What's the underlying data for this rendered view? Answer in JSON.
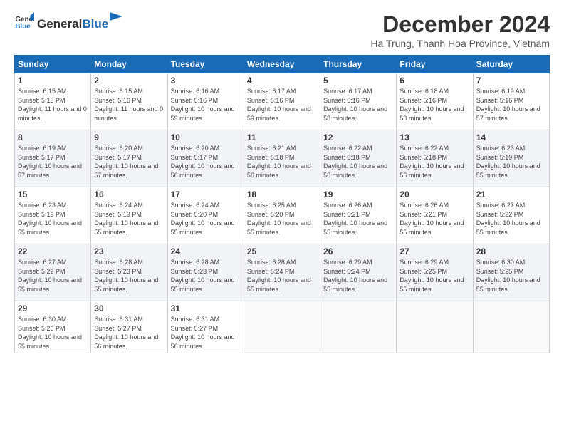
{
  "logo": {
    "general": "General",
    "blue": "Blue"
  },
  "header": {
    "month": "December 2024",
    "location": "Ha Trung, Thanh Hoa Province, Vietnam"
  },
  "weekdays": [
    "Sunday",
    "Monday",
    "Tuesday",
    "Wednesday",
    "Thursday",
    "Friday",
    "Saturday"
  ],
  "weeks": [
    [
      {
        "day": "1",
        "sunrise": "6:15 AM",
        "sunset": "5:15 PM",
        "daylight": "11 hours and 0 minutes."
      },
      {
        "day": "2",
        "sunrise": "6:15 AM",
        "sunset": "5:16 PM",
        "daylight": "11 hours and 0 minutes."
      },
      {
        "day": "3",
        "sunrise": "6:16 AM",
        "sunset": "5:16 PM",
        "daylight": "10 hours and 59 minutes."
      },
      {
        "day": "4",
        "sunrise": "6:17 AM",
        "sunset": "5:16 PM",
        "daylight": "10 hours and 59 minutes."
      },
      {
        "day": "5",
        "sunrise": "6:17 AM",
        "sunset": "5:16 PM",
        "daylight": "10 hours and 58 minutes."
      },
      {
        "day": "6",
        "sunrise": "6:18 AM",
        "sunset": "5:16 PM",
        "daylight": "10 hours and 58 minutes."
      },
      {
        "day": "7",
        "sunrise": "6:19 AM",
        "sunset": "5:16 PM",
        "daylight": "10 hours and 57 minutes."
      }
    ],
    [
      {
        "day": "8",
        "sunrise": "6:19 AM",
        "sunset": "5:17 PM",
        "daylight": "10 hours and 57 minutes."
      },
      {
        "day": "9",
        "sunrise": "6:20 AM",
        "sunset": "5:17 PM",
        "daylight": "10 hours and 57 minutes."
      },
      {
        "day": "10",
        "sunrise": "6:20 AM",
        "sunset": "5:17 PM",
        "daylight": "10 hours and 56 minutes."
      },
      {
        "day": "11",
        "sunrise": "6:21 AM",
        "sunset": "5:18 PM",
        "daylight": "10 hours and 56 minutes."
      },
      {
        "day": "12",
        "sunrise": "6:22 AM",
        "sunset": "5:18 PM",
        "daylight": "10 hours and 56 minutes."
      },
      {
        "day": "13",
        "sunrise": "6:22 AM",
        "sunset": "5:18 PM",
        "daylight": "10 hours and 56 minutes."
      },
      {
        "day": "14",
        "sunrise": "6:23 AM",
        "sunset": "5:19 PM",
        "daylight": "10 hours and 55 minutes."
      }
    ],
    [
      {
        "day": "15",
        "sunrise": "6:23 AM",
        "sunset": "5:19 PM",
        "daylight": "10 hours and 55 minutes."
      },
      {
        "day": "16",
        "sunrise": "6:24 AM",
        "sunset": "5:19 PM",
        "daylight": "10 hours and 55 minutes."
      },
      {
        "day": "17",
        "sunrise": "6:24 AM",
        "sunset": "5:20 PM",
        "daylight": "10 hours and 55 minutes."
      },
      {
        "day": "18",
        "sunrise": "6:25 AM",
        "sunset": "5:20 PM",
        "daylight": "10 hours and 55 minutes."
      },
      {
        "day": "19",
        "sunrise": "6:26 AM",
        "sunset": "5:21 PM",
        "daylight": "10 hours and 55 minutes."
      },
      {
        "day": "20",
        "sunrise": "6:26 AM",
        "sunset": "5:21 PM",
        "daylight": "10 hours and 55 minutes."
      },
      {
        "day": "21",
        "sunrise": "6:27 AM",
        "sunset": "5:22 PM",
        "daylight": "10 hours and 55 minutes."
      }
    ],
    [
      {
        "day": "22",
        "sunrise": "6:27 AM",
        "sunset": "5:22 PM",
        "daylight": "10 hours and 55 minutes."
      },
      {
        "day": "23",
        "sunrise": "6:28 AM",
        "sunset": "5:23 PM",
        "daylight": "10 hours and 55 minutes."
      },
      {
        "day": "24",
        "sunrise": "6:28 AM",
        "sunset": "5:23 PM",
        "daylight": "10 hours and 55 minutes."
      },
      {
        "day": "25",
        "sunrise": "6:28 AM",
        "sunset": "5:24 PM",
        "daylight": "10 hours and 55 minutes."
      },
      {
        "day": "26",
        "sunrise": "6:29 AM",
        "sunset": "5:24 PM",
        "daylight": "10 hours and 55 minutes."
      },
      {
        "day": "27",
        "sunrise": "6:29 AM",
        "sunset": "5:25 PM",
        "daylight": "10 hours and 55 minutes."
      },
      {
        "day": "28",
        "sunrise": "6:30 AM",
        "sunset": "5:25 PM",
        "daylight": "10 hours and 55 minutes."
      }
    ],
    [
      {
        "day": "29",
        "sunrise": "6:30 AM",
        "sunset": "5:26 PM",
        "daylight": "10 hours and 55 minutes."
      },
      {
        "day": "30",
        "sunrise": "6:31 AM",
        "sunset": "5:27 PM",
        "daylight": "10 hours and 56 minutes."
      },
      {
        "day": "31",
        "sunrise": "6:31 AM",
        "sunset": "5:27 PM",
        "daylight": "10 hours and 56 minutes."
      },
      null,
      null,
      null,
      null
    ]
  ]
}
